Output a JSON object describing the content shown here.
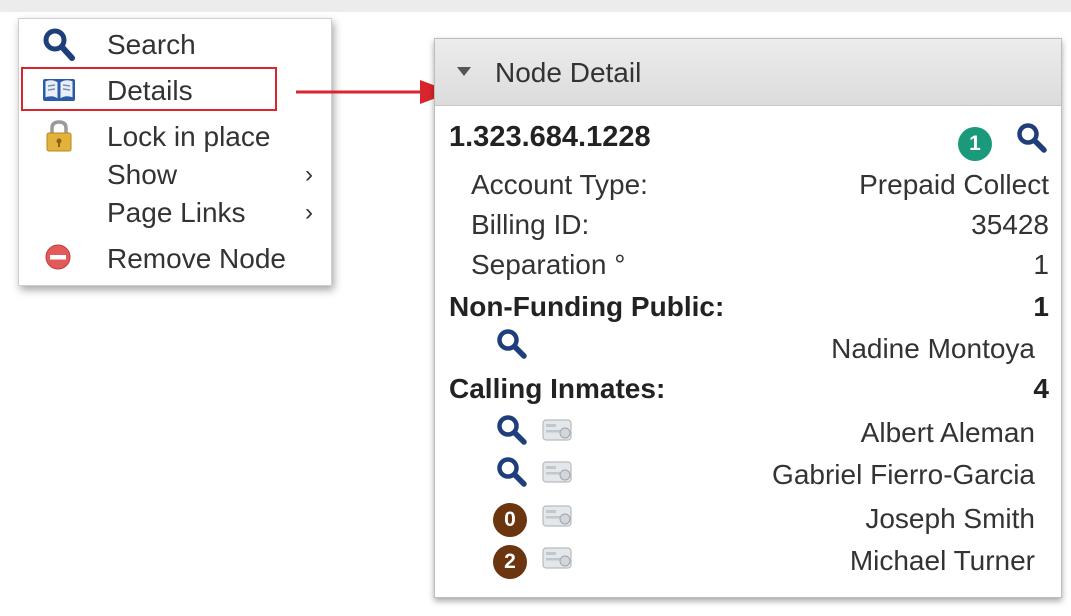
{
  "context_menu": {
    "items": [
      {
        "label": "Search",
        "icon": "search-icon"
      },
      {
        "label": "Details",
        "icon": "book-icon"
      },
      {
        "label": "Lock in place",
        "icon": "lock-icon"
      },
      {
        "label": "Show",
        "icon": "",
        "submenu": true
      },
      {
        "label": "Page Links",
        "icon": "",
        "submenu": true
      },
      {
        "label": "Remove Node",
        "icon": "remove-icon"
      }
    ],
    "submenu_arrow": "›",
    "highlight_color": "#d9262c"
  },
  "node_detail": {
    "title": "Node Detail",
    "phone": "1.323.684.1228",
    "header_badge": "1",
    "fields": [
      {
        "label": "Account Type:",
        "value": "Prepaid Collect"
      },
      {
        "label": "Billing ID:",
        "value": "35428"
      },
      {
        "label": "Separation °",
        "value": "1"
      }
    ],
    "non_funding": {
      "label": "Non-Funding Public:",
      "count": "1",
      "people": [
        {
          "name": "Nadine Montoya",
          "lead": "search-icon"
        }
      ]
    },
    "calling_inmates": {
      "label": "Calling Inmates:",
      "count": "4",
      "people": [
        {
          "name": "Albert Aleman",
          "lead": "search-icon",
          "badge": ""
        },
        {
          "name": "Gabriel Fierro-Garcia",
          "lead": "search-icon",
          "badge": ""
        },
        {
          "name": "Joseph Smith",
          "lead": "badge",
          "badge": "0"
        },
        {
          "name": "Michael Turner",
          "lead": "badge",
          "badge": "2"
        }
      ]
    },
    "colors": {
      "green_badge": "#1a9a7b",
      "brown_badge": "#6b3510",
      "search_icon": "#1f3f7a"
    }
  }
}
